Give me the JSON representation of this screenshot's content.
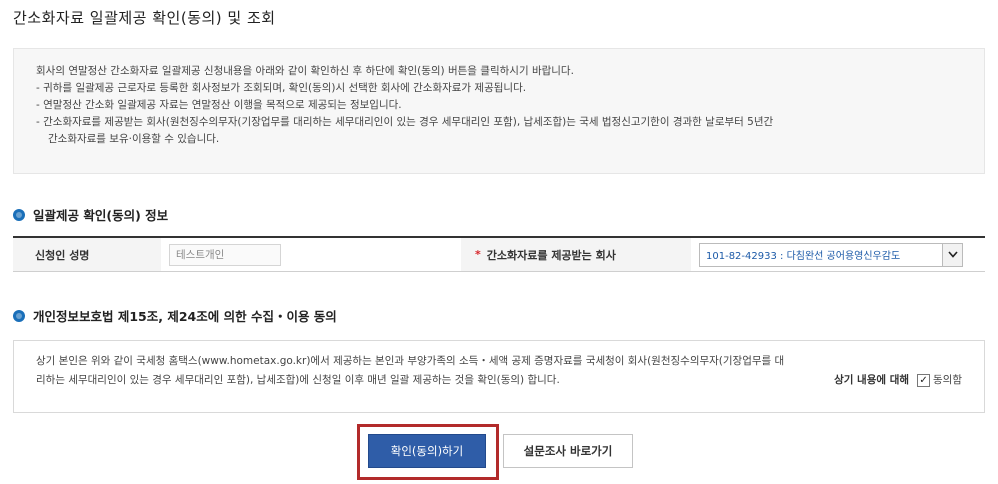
{
  "page": {
    "title": "간소화자료 일괄제공 확인(동의) 및 조회"
  },
  "notice": {
    "lines": [
      "회사의 연말정산 간소화자료 일괄제공 신청내용을 아래와 같이 확인하신 후 하단에 확인(동의) 버튼을 클릭하시기 바랍니다.",
      "- 귀하를 일괄제공 근로자로 등록한 회사정보가 조회되며, 확인(동의)시 선택한 회사에 간소화자료가 제공됩니다.",
      "- 연말정산 간소화 일괄제공 자료는 연말정산 이행을 목적으로 제공되는 정보입니다.",
      "- 간소화자료를 제공받는 회사(원천징수의무자(기장업무를 대리하는 세무대리인이 있는 경우 세무대리인 포함), 납세조합)는 국세 법정신고기한이 경과한 날로부터 5년간",
      "간소화자료를 보유·이용할 수 있습니다."
    ]
  },
  "info_section": {
    "title": "일괄제공 확인(동의) 정보",
    "applicant_label": "신청인 성명",
    "applicant_value": "테스트개인",
    "required_mark": "*",
    "company_label": "간소화자료를 제공받는 회사",
    "company_value": "101-82-42933 : 다침완선 공어용영신우감도",
    "select_icon": "chevron-down-icon"
  },
  "consent_section": {
    "title": "개인정보보호법 제15조, 제24조에 의한 수집・이용 동의",
    "text_line1": "상기 본인은 위와 같이 국세청 홈택스(www.hometax.go.kr)에서 제공하는 본인과 부양가족의 소득・세액 공제 증명자료를 국세청이 회사(원천징수의무자(기장업무를 대",
    "text_line2": "리하는 세무대리인이 있는 경우 세무대리인 포함), 납세조합)에 신청일 이후 매년 일괄 제공하는 것을 확인(동의) 합니다.",
    "agree_prefix": "상기 내용에 대해",
    "checkbox_mark": "✓",
    "checkbox_checked": true,
    "agree_label": "동의함"
  },
  "buttons": {
    "confirm_label": "확인(동의)하기",
    "survey_label": "설문조사 바로가기"
  },
  "colors": {
    "accent": "#2f5da8",
    "bullet": "#1a6fb9",
    "highlight": "#b22a2a",
    "required": "#d7262b"
  }
}
